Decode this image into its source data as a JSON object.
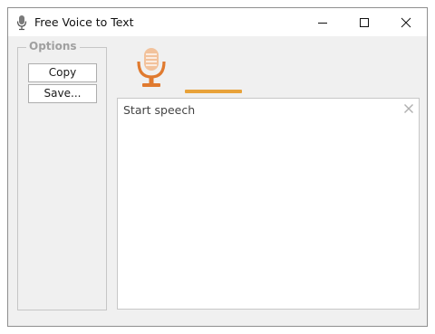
{
  "window": {
    "title": "Free Voice to Text",
    "icon": "microphone-icon",
    "controls": [
      "minimize-icon",
      "maximize-icon",
      "close-icon"
    ]
  },
  "options": {
    "legend": "Options",
    "copy_label": "Copy",
    "save_label": "Save..."
  },
  "recorder": {
    "icon": "microphone-icon",
    "accent_color": "#e07a2f",
    "level_color": "#e8a23a"
  },
  "speech": {
    "text": "Start speech",
    "clear_icon": "clear-x-icon"
  }
}
